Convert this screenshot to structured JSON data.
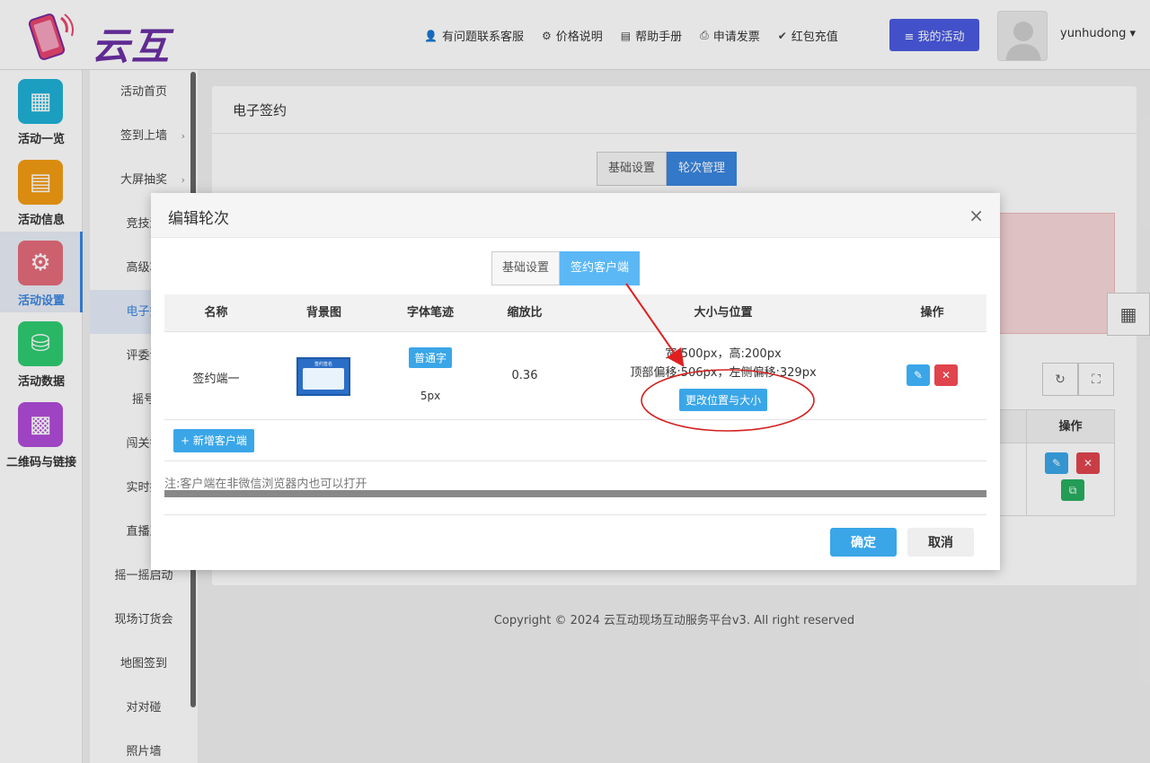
{
  "brand": {
    "name": "云互动"
  },
  "header": {
    "nav": [
      {
        "icon": "user-plus-icon",
        "glyph": "👤",
        "label": "有问题联系客服"
      },
      {
        "icon": "settings-icon",
        "glyph": "⚙",
        "label": "价格说明"
      },
      {
        "icon": "book-icon",
        "glyph": "▤",
        "label": "帮助手册"
      },
      {
        "icon": "printer-icon",
        "glyph": "⎙",
        "label": "申请发票"
      },
      {
        "icon": "shield-check-icon",
        "glyph": "✔",
        "label": "红包充值"
      }
    ],
    "my_activity": "≡ 我的活动",
    "username": "yunhudong ▾"
  },
  "side1": [
    {
      "label": "活动一览",
      "color": "#1fb0d6",
      "glyph": "▦",
      "icon": "grid-icon"
    },
    {
      "label": "活动信息",
      "color": "#f39c12",
      "glyph": "▤",
      "icon": "document-icon"
    },
    {
      "label": "活动设置",
      "color": "#e56b7a",
      "glyph": "⚙",
      "icon": "gear-icon"
    },
    {
      "label": "活动数据",
      "color": "#2ecc71",
      "glyph": "⛁",
      "icon": "database-icon"
    },
    {
      "label": "二维码与链接",
      "color": "#b04bd8",
      "glyph": "▩",
      "icon": "qrcode-icon"
    }
  ],
  "side2": [
    {
      "label": "活动首页",
      "arrow": ""
    },
    {
      "label": "签到上墙",
      "arrow": "›"
    },
    {
      "label": "大屏抽奖",
      "arrow": "›"
    },
    {
      "label": "竞技游",
      "arrow": ""
    },
    {
      "label": "高级功",
      "arrow": ""
    },
    {
      "label": "电子签",
      "arrow": ""
    },
    {
      "label": "评委评",
      "arrow": ""
    },
    {
      "label": "摇号",
      "arrow": ""
    },
    {
      "label": "闯关答",
      "arrow": ""
    },
    {
      "label": "实时投",
      "arrow": ""
    },
    {
      "label": "直播互",
      "arrow": ""
    },
    {
      "label": "摇一摇启动",
      "arrow": ""
    },
    {
      "label": "现场订货会",
      "arrow": ""
    },
    {
      "label": "地图签到",
      "arrow": ""
    },
    {
      "label": "对对碰",
      "arrow": ""
    },
    {
      "label": "照片墙",
      "arrow": ""
    }
  ],
  "panel": {
    "title": "电子签约",
    "tabs": [
      "基础设置",
      "轮次管理"
    ],
    "table_head_action": "操作",
    "row_cut_num": "2"
  },
  "footer": "Copyright © 2024 云互动现场互动服务平台v3. All right reserved",
  "modal": {
    "title": "编辑轮次",
    "close": "×",
    "tabs": [
      "基础设置",
      "签约客户端"
    ],
    "headers": [
      "名称",
      "背景图",
      "字体笔迹",
      "缩放比",
      "大小与位置",
      "操作"
    ],
    "row": {
      "name": "签约端一",
      "thumb_title": "签约签名",
      "font_type": "普通字",
      "stroke": "5px",
      "scale": "0.36",
      "size": "宽:500px，高:200px",
      "offset": "顶部偏移:506px，左侧偏移:329px",
      "change_btn": "更改位置与大小"
    },
    "add_btn": "+ 新增客户端",
    "note": "注:客户端在非微信浏览器内也可以打开",
    "ok": "确定",
    "cancel": "取消"
  },
  "colors": {
    "primary": "#3a86e0",
    "accent_blue": "#3aa6e8",
    "brand_purple": "#6b2fa3",
    "danger": "#e0444d",
    "success": "#27ae60",
    "annotation": "#e02020"
  }
}
